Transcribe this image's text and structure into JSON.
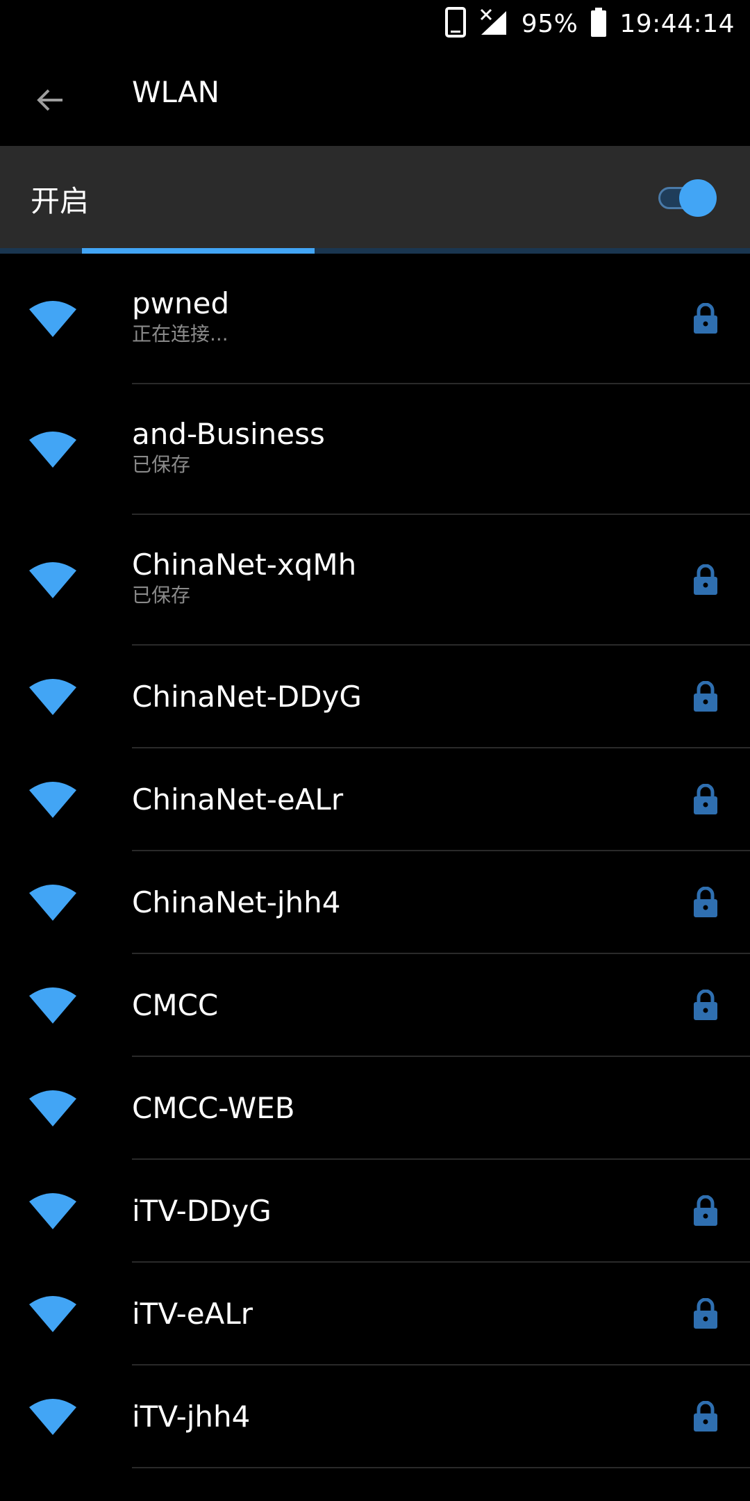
{
  "status_bar": {
    "battery_percent": "95%",
    "time": "19:44:14",
    "icons": [
      "phone-icon",
      "signal-no-sim-icon",
      "battery-icon"
    ]
  },
  "app_bar": {
    "back_icon": "back-arrow-icon",
    "title": "WLAN"
  },
  "wlan_toggle": {
    "label": "开启",
    "enabled": true
  },
  "scan_progress": 0.31,
  "colors": {
    "accent": "#42a5f5",
    "background": "#000000",
    "toggle_row_bg": "#2b2b2b",
    "lock": "#2f6fb0",
    "subtext": "#8a8a8a"
  },
  "networks": [
    {
      "ssid": "pwned",
      "status": "正在连接...",
      "secured": true
    },
    {
      "ssid": "and-Business",
      "status": "已保存",
      "secured": false
    },
    {
      "ssid": "ChinaNet-xqMh",
      "status": "已保存",
      "secured": true
    },
    {
      "ssid": "ChinaNet-DDyG",
      "status": "",
      "secured": true
    },
    {
      "ssid": "ChinaNet-eALr",
      "status": "",
      "secured": true
    },
    {
      "ssid": "ChinaNet-jhh4",
      "status": "",
      "secured": true
    },
    {
      "ssid": "CMCC",
      "status": "",
      "secured": true
    },
    {
      "ssid": "CMCC-WEB",
      "status": "",
      "secured": false
    },
    {
      "ssid": "iTV-DDyG",
      "status": "",
      "secured": true
    },
    {
      "ssid": "iTV-eALr",
      "status": "",
      "secured": true
    },
    {
      "ssid": "iTV-jhh4",
      "status": "",
      "secured": true
    }
  ]
}
